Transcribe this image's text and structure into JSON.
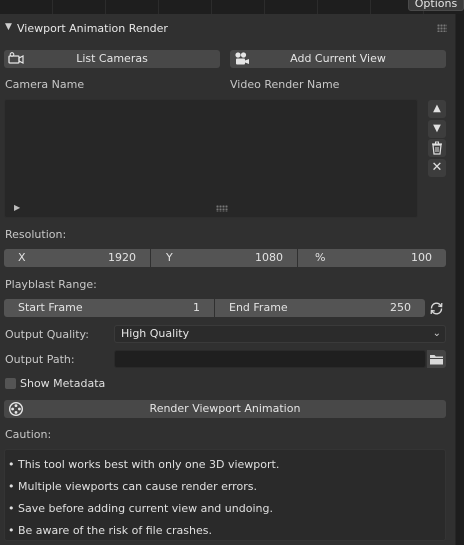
{
  "options_label": "Options",
  "panel": {
    "title": "Viewport Animation Render"
  },
  "buttons": {
    "list_cameras": "List Cameras",
    "add_current_view": "Add Current View",
    "render": "Render Viewport Animation"
  },
  "columns": {
    "camera_name": "Camera Name",
    "video_render_name": "Video Render Name"
  },
  "resolution": {
    "label": "Resolution:",
    "x_label": "X",
    "x_value": "1920",
    "y_label": "Y",
    "y_value": "1080",
    "pct_label": "%",
    "pct_value": "100"
  },
  "playblast": {
    "label": "Playblast Range:",
    "start_label": "Start Frame",
    "start_value": "1",
    "end_label": "End Frame",
    "end_value": "250"
  },
  "output_quality": {
    "label": "Output Quality:",
    "value": "High Quality"
  },
  "output_path": {
    "label": "Output Path:",
    "value": ""
  },
  "show_metadata": {
    "label": "Show Metadata",
    "checked": false
  },
  "caution": {
    "label": "Caution:",
    "lines": [
      "• This tool works best with only one 3D viewport.",
      "• Multiple viewports can cause render errors.",
      "• Save before adding current view and undoing.",
      "• Be aware of the risk of file crashes."
    ]
  },
  "icons": {
    "camera": "camera-icon",
    "movie_camera": "movie-camera-icon",
    "arrow_up": "arrow-up-icon",
    "arrow_down": "arrow-down-icon",
    "trash": "trash-icon",
    "close": "close-icon",
    "refresh": "refresh-icon",
    "folder": "folder-icon",
    "film_reel": "film-reel-icon"
  }
}
